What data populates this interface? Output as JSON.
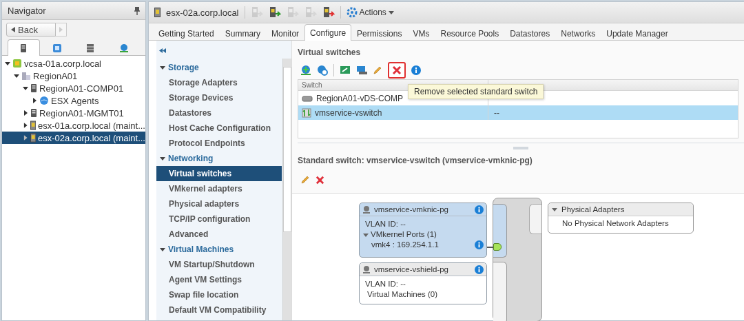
{
  "navigator": {
    "title": "Navigator",
    "back_label": "Back",
    "tabs": [
      {
        "kind": "hosts",
        "selected": true
      },
      {
        "kind": "vms",
        "selected": false
      },
      {
        "kind": "storage",
        "selected": false
      },
      {
        "kind": "network",
        "selected": false
      }
    ],
    "tree": [
      {
        "label": "vcsa-01a.corp.local",
        "kind": "vcenter",
        "expanded": true,
        "selected": false,
        "children": [
          {
            "label": "RegionA01",
            "kind": "datacenter",
            "expanded": true,
            "selected": false,
            "children": [
              {
                "label": "RegionA01-COMP01",
                "kind": "cluster",
                "expanded": true,
                "selected": false,
                "children": [
                  {
                    "label": "ESX Agents",
                    "kind": "pool",
                    "expanded": false,
                    "selected": false
                  }
                ]
              },
              {
                "label": "RegionA01-MGMT01",
                "kind": "cluster",
                "expanded": false,
                "selected": false
              },
              {
                "label": "esx-01a.corp.local (maint...",
                "kind": "host",
                "expanded": false,
                "selected": false
              },
              {
                "label": "esx-02a.corp.local (maint...",
                "kind": "host",
                "expanded": false,
                "selected": true
              }
            ]
          }
        ]
      }
    ]
  },
  "header": {
    "object_name": "esx-02a.corp.local",
    "actions_label": "Actions",
    "tools": [
      {
        "kind": "host-add",
        "disabled": true
      },
      {
        "kind": "host-connect",
        "disabled": false
      },
      {
        "kind": "host-exit",
        "disabled": true
      },
      {
        "kind": "host-maint",
        "disabled": true
      },
      {
        "kind": "host-refresh",
        "disabled": false
      }
    ]
  },
  "tabs": [
    {
      "label": "Getting Started",
      "selected": false
    },
    {
      "label": "Summary",
      "selected": false
    },
    {
      "label": "Monitor",
      "selected": false
    },
    {
      "label": "Configure",
      "selected": true
    },
    {
      "label": "Permissions",
      "selected": false
    },
    {
      "label": "VMs",
      "selected": false
    },
    {
      "label": "Resource Pools",
      "selected": false
    },
    {
      "label": "Datastores",
      "selected": false
    },
    {
      "label": "Networks",
      "selected": false
    },
    {
      "label": "Update Manager",
      "selected": false
    }
  ],
  "settings": [
    {
      "title": "Storage",
      "expanded": true,
      "items": [
        {
          "label": "Storage Adapters",
          "selected": false
        },
        {
          "label": "Storage Devices",
          "selected": false
        },
        {
          "label": "Datastores",
          "selected": false
        },
        {
          "label": "Host Cache Configuration",
          "selected": false
        },
        {
          "label": "Protocol Endpoints",
          "selected": false
        }
      ]
    },
    {
      "title": "Networking",
      "expanded": true,
      "items": [
        {
          "label": "Virtual switches",
          "selected": true
        },
        {
          "label": "VMkernel adapters",
          "selected": false
        },
        {
          "label": "Physical adapters",
          "selected": false
        },
        {
          "label": "TCP/IP configuration",
          "selected": false
        },
        {
          "label": "Advanced",
          "selected": false
        }
      ]
    },
    {
      "title": "Virtual Machines",
      "expanded": true,
      "items": [
        {
          "label": "VM Startup/Shutdown",
          "selected": false
        },
        {
          "label": "Agent VM Settings",
          "selected": false
        },
        {
          "label": "Swap file location",
          "selected": false
        },
        {
          "label": "Default VM Compatibility",
          "selected": false
        }
      ]
    }
  ],
  "virtual_switches": {
    "title": "Virtual switches",
    "tooltip": "Remove selected standard switch",
    "table": {
      "columns": [
        "Switch"
      ],
      "rows": [
        {
          "switch": "RegionA01-vDS-COMP",
          "kind": "distributed",
          "selected": false
        },
        {
          "switch": "vmservice-vswitch",
          "kind": "standard",
          "column_2": "--",
          "selected": true
        }
      ]
    }
  },
  "detail": {
    "title": "Standard switch: vmservice-vswitch (vmservice-vmknic-pg)",
    "port_groups": [
      {
        "name": "vmservice-vmknic-pg",
        "selected": true,
        "vlan": "VLAN ID: --",
        "section": "VMkernel Ports (1)",
        "section_expanded": true,
        "entries": [
          "vmk4 : 169.254.1.1"
        ]
      },
      {
        "name": "vmservice-vshield-pg",
        "selected": false,
        "vlan": "VLAN ID: --",
        "section": "Virtual Machines (0)"
      }
    ],
    "physical_adapters": {
      "title": "Physical Adapters",
      "expanded": true,
      "message": "No Physical Network Adapters"
    }
  }
}
